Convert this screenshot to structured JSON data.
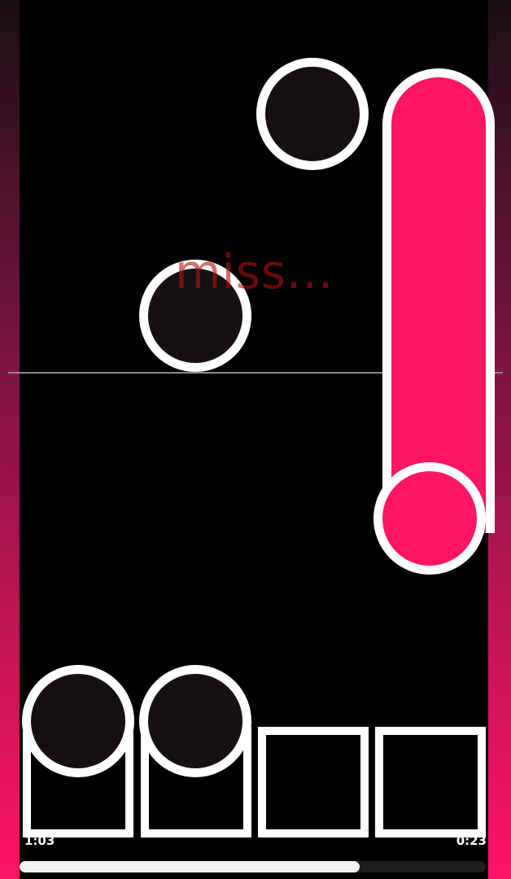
{
  "feedback": {
    "text": "miss..."
  },
  "time": {
    "elapsed": "1:03",
    "remaining": "0:23"
  },
  "progress": {
    "fraction": 0.73
  },
  "colors": {
    "accent": "#ff1466",
    "note_fill": "#151012",
    "outline": "#ffffff",
    "miss": "#b01010"
  },
  "lanes": [
    {
      "name": "lane-1"
    },
    {
      "name": "lane-2"
    },
    {
      "name": "lane-3"
    },
    {
      "name": "lane-4"
    }
  ]
}
